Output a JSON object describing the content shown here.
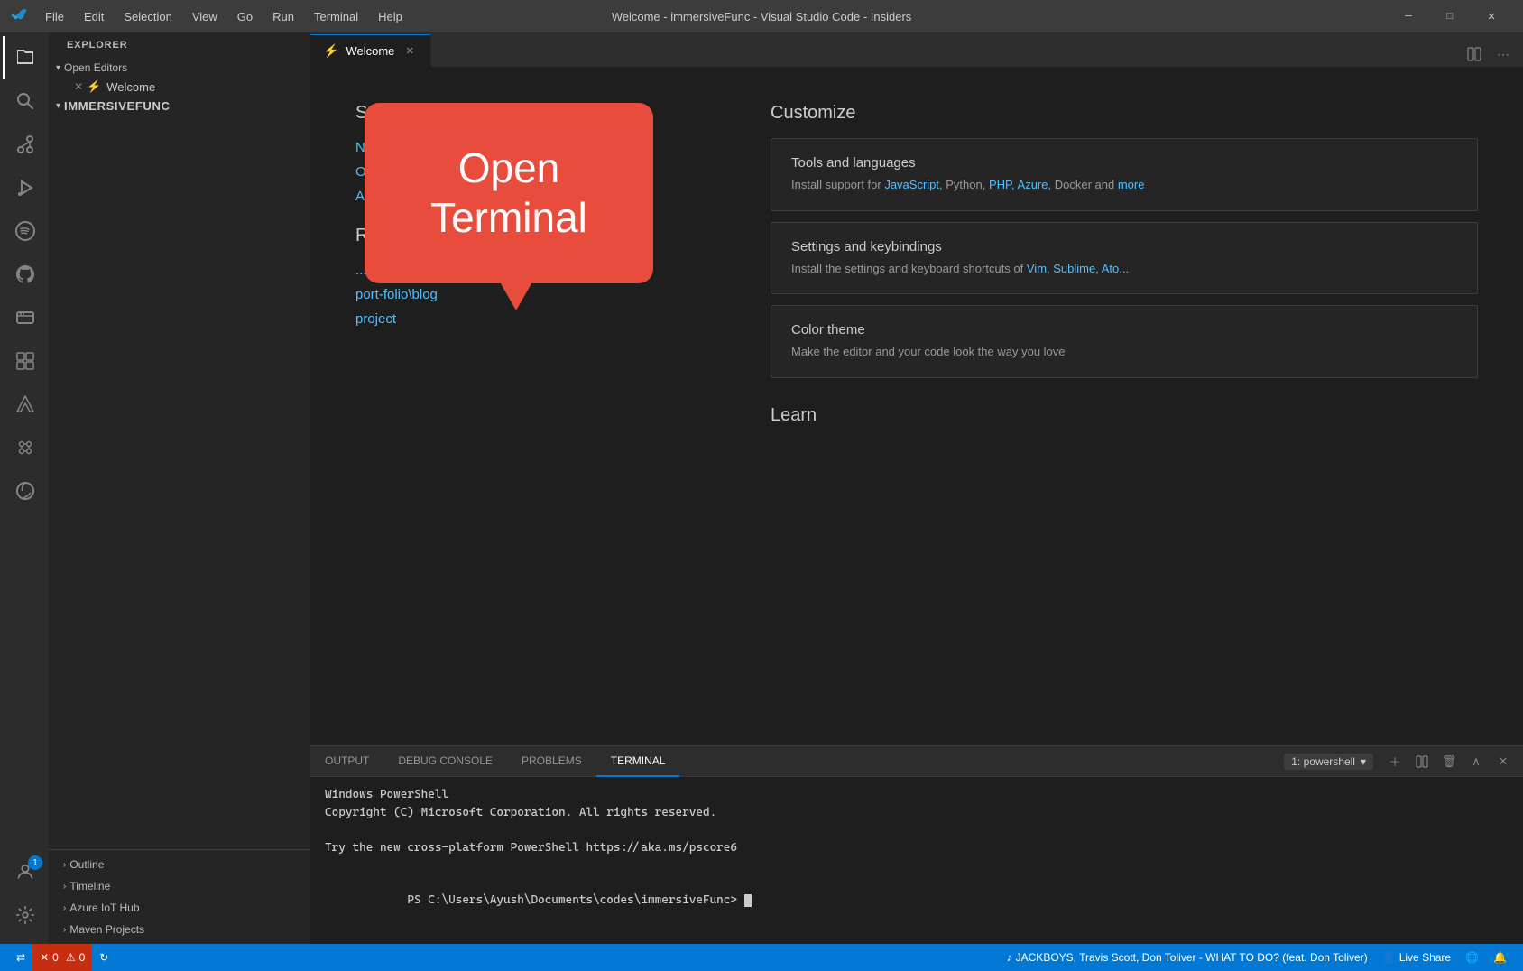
{
  "titlebar": {
    "title": "Welcome - immersiveFunc - Visual Studio Code - Insiders",
    "menus": [
      "File",
      "Edit",
      "Selection",
      "View",
      "Go",
      "Run",
      "Terminal",
      "Help"
    ],
    "win_minimize": "─",
    "win_maximize": "□",
    "win_close": "✕"
  },
  "activity_bar": {
    "items": [
      {
        "id": "explorer",
        "icon": "⊞",
        "label": "Explorer",
        "active": true
      },
      {
        "id": "search",
        "icon": "🔍",
        "label": "Search"
      },
      {
        "id": "source-control",
        "icon": "⑂",
        "label": "Source Control"
      },
      {
        "id": "run",
        "icon": "▷",
        "label": "Run and Debug"
      },
      {
        "id": "spotify",
        "icon": "♫",
        "label": "Spotify"
      },
      {
        "id": "github",
        "icon": "◎",
        "label": "GitHub"
      },
      {
        "id": "remote",
        "icon": "⬚",
        "label": "Remote Explorer"
      },
      {
        "id": "extensions",
        "icon": "⧉",
        "label": "Extensions"
      },
      {
        "id": "azure",
        "icon": "△",
        "label": "Azure"
      },
      {
        "id": "npm",
        "icon": "✿",
        "label": "NPM Scripts"
      },
      {
        "id": "edge",
        "icon": "◈",
        "label": "Edge DevTools"
      }
    ],
    "bottom": [
      {
        "id": "accounts",
        "icon": "⚙",
        "label": "Accounts",
        "badge": "1"
      },
      {
        "id": "settings",
        "icon": "⚙",
        "label": "Settings"
      }
    ]
  },
  "sidebar": {
    "title": "Explorer",
    "open_editors_label": "Open Editors",
    "open_editors_expanded": true,
    "open_editors": [
      {
        "name": "Welcome",
        "icon": "⚡",
        "dirty": false
      }
    ],
    "folder_name": "ImmersiveFunc",
    "bottom_sections": [
      {
        "label": "Outline",
        "expanded": false
      },
      {
        "label": "Timeline",
        "expanded": false
      },
      {
        "label": "Azure IoT Hub",
        "expanded": false
      },
      {
        "label": "Maven Projects",
        "expanded": false
      }
    ]
  },
  "tabs": [
    {
      "id": "welcome",
      "label": "Welcome",
      "icon": "⚡",
      "active": true,
      "dirty": false
    }
  ],
  "welcome": {
    "start_section": "Start",
    "links": [
      {
        "id": "new-file",
        "label": "New file"
      },
      {
        "id": "open-folder",
        "label": "Open folder..."
      },
      {
        "id": "add-workspace",
        "label": "Add workspace folder..."
      }
    ],
    "recent_header": "Recent",
    "recent_items": [
      {
        "label": "...\\Ayush\\Documents\\cod..."
      },
      {
        "label": "port-folio\\blog"
      },
      {
        "label": "project"
      }
    ],
    "customize_section": "Customize",
    "cards": [
      {
        "id": "tools",
        "title": "Tools and languages",
        "desc": "Install support for ",
        "links": [
          "JavaScript",
          "Python",
          "PHP",
          "Azure",
          "Docker"
        ],
        "suffix": " and more"
      },
      {
        "id": "settings",
        "title": "Settings and keybindings",
        "desc": "Install the settings and keyboard shortcuts of ",
        "links": [
          "Vim",
          "Sublime",
          "Ato..."
        ]
      },
      {
        "id": "theme",
        "title": "Color theme",
        "desc": "Make the editor and your code look the way you love"
      }
    ],
    "learn_section": "Learn"
  },
  "terminal_popup": {
    "line1": "Open",
    "line2": "Terminal"
  },
  "terminal": {
    "tabs": [
      "OUTPUT",
      "DEBUG CONSOLE",
      "PROBLEMS",
      "TERMINAL"
    ],
    "active_tab": "TERMINAL",
    "dropdown_label": "1: powershell",
    "lines": [
      "Windows PowerShell",
      "Copyright (C) Microsoft Corporation. All rights reserved.",
      "",
      "Try the new cross-platform PowerShell https://aka.ms/pscore6",
      "",
      "PS C:\\Users\\Ayush\\Documents\\codes\\immersiveFunc> "
    ]
  },
  "statusbar": {
    "left_items": [
      {
        "id": "remote",
        "icon": "⇄",
        "label": ""
      },
      {
        "id": "errors",
        "icon": "✕",
        "errors": "0",
        "warnings": "0",
        "error_icon": "⚠"
      },
      {
        "id": "sync",
        "icon": "↻",
        "label": ""
      }
    ],
    "music": "JACKBOYS, Travis Scott, Don Toliver - WHAT TO DO? (feat. Don Toliver)",
    "live_share": "Live Share",
    "right_items": [
      {
        "id": "notifications",
        "icon": "🔔"
      },
      {
        "id": "broadcast",
        "icon": "📡"
      }
    ]
  }
}
